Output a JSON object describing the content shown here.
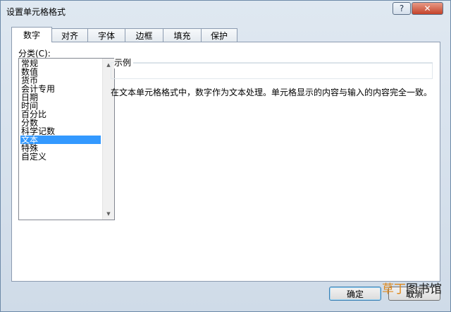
{
  "window": {
    "title": "设置单元格格式",
    "help_glyph": "?",
    "close_glyph": "✕"
  },
  "tabs": [
    {
      "label": "数字",
      "active": true
    },
    {
      "label": "对齐",
      "active": false
    },
    {
      "label": "字体",
      "active": false
    },
    {
      "label": "边框",
      "active": false
    },
    {
      "label": "填充",
      "active": false
    },
    {
      "label": "保护",
      "active": false
    }
  ],
  "category": {
    "label": "分类(C):",
    "items": [
      "常规",
      "数值",
      "货币",
      "会计专用",
      "日期",
      "时间",
      "百分比",
      "分数",
      "科学记数",
      "文本",
      "特殊",
      "自定义"
    ],
    "selected": "文本"
  },
  "sample": {
    "legend": "示例",
    "value": ""
  },
  "description": "在文本单元格格式中，数字作为文本处理。单元格显示的内容与输入的内容完全一致。",
  "buttons": {
    "ok": "确定",
    "cancel": "取消"
  },
  "watermark": {
    "part1": "草丁",
    "part2": "图书馆",
    "accent_color": "#e08a1e"
  },
  "colors": {
    "selection": "#3399ff"
  }
}
